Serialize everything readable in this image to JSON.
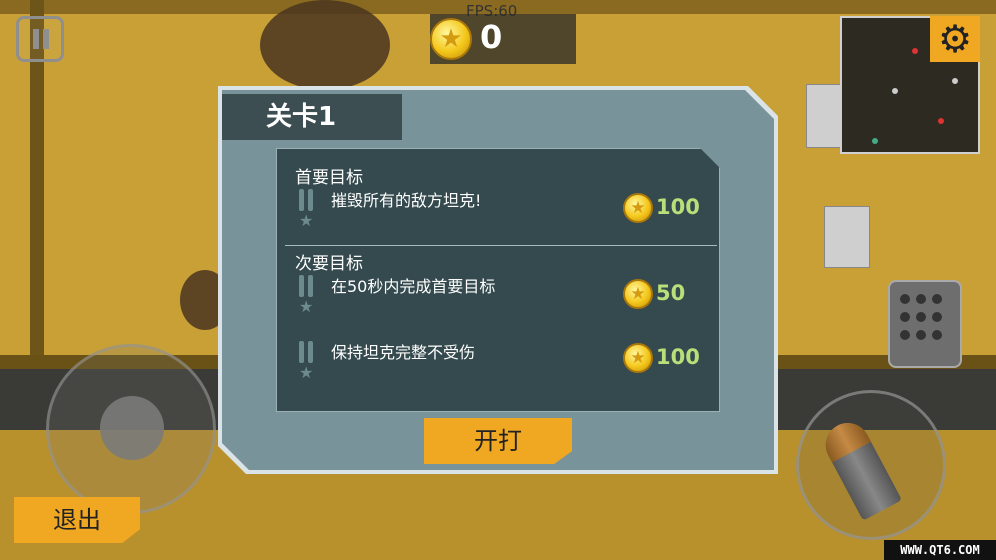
{
  "hud": {
    "fps": "FPS:60",
    "coins": "0",
    "exit_label": "退出"
  },
  "dialog": {
    "level_title": "关卡1",
    "primary_heading": "首要目标",
    "secondary_heading": "次要目标",
    "tasks": [
      {
        "text": "摧毁所有的敌方坦克!",
        "reward": "100"
      },
      {
        "text": "在50秒内完成首要目标",
        "reward": "50"
      },
      {
        "text": "保持坦克完整不受伤",
        "reward": "100"
      }
    ],
    "start_label": "开打"
  },
  "watermark": "WWW.QT6.COM",
  "colors": {
    "accent": "#f0a822",
    "panel": "#344a4e",
    "reward_text": "#b8e07a"
  }
}
